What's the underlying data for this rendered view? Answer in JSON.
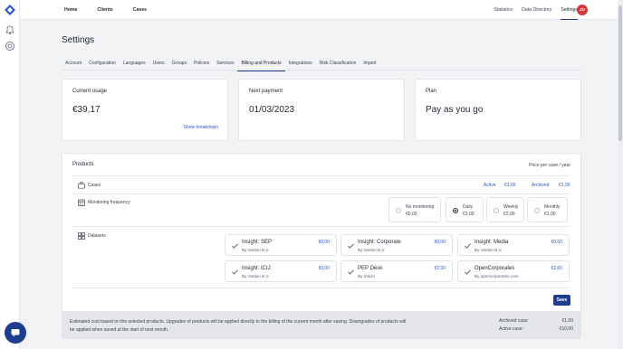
{
  "topnav": {
    "left": [
      "Home",
      "Clients",
      "Cases"
    ],
    "right": [
      "Statistics",
      "Data Directory",
      "Settings"
    ],
    "active": "Settings",
    "avatar_initials": "JD"
  },
  "page": {
    "title": "Settings"
  },
  "tabs": [
    "Account",
    "Configuration",
    "Languages",
    "Users",
    "Groups",
    "Policies",
    "Services",
    "Billing and Products",
    "Integrations",
    "Risk Classification",
    "Import"
  ],
  "active_tab": "Billing and Products",
  "summary": {
    "current_usage": {
      "label": "Current usage",
      "value": "€39,17",
      "link": "Show breakdown"
    },
    "next_payment": {
      "label": "Next payment",
      "value": "01/03/2023"
    },
    "plan": {
      "label": "Plan",
      "value": "Pay as you go"
    }
  },
  "products": {
    "title": "Products",
    "price_header": "Price per case / year",
    "cases": {
      "label": "Cases",
      "active_label": "Active",
      "active_price": "€3,00",
      "archived_label": "Archived",
      "archived_price": "€1,00"
    },
    "monitoring": {
      "label": "Monitoring frequency",
      "options": [
        {
          "name": "No monitoring",
          "price": "€0,00",
          "selected": false
        },
        {
          "name": "Daily",
          "price": "€3,00",
          "selected": true
        },
        {
          "name": "Weekly",
          "price": "€2,00",
          "selected": false
        },
        {
          "name": "Monthly",
          "price": "€1,00",
          "selected": false
        }
      ]
    },
    "datasets": {
      "label": "Datasets",
      "items": [
        {
          "name": "Insight: SEP",
          "by": "By Vartion B.V.",
          "price": "€0,00"
        },
        {
          "name": "Insight: Corporate",
          "by": "By Vartion B.V.",
          "price": "€0,00"
        },
        {
          "name": "Insight: Media",
          "by": "By Vartion B.V.",
          "price": "€0,00"
        },
        {
          "name": "Insight: ICIJ",
          "by": "By Vartion B.V.",
          "price": "€0,00"
        },
        {
          "name": "PEP Desk",
          "by": "By Info4c",
          "price": "€2,00"
        },
        {
          "name": "OpenCorporates",
          "by": "By opencorporates.com",
          "price": "€2,00"
        }
      ]
    },
    "save_label": "Save"
  },
  "footer": {
    "note": "Estimated cost based on the selected products. Upgrades of products will be applied directly to the billing of the current month after saving. Downgrades of products will be applied when saved at the start of next month.",
    "archived_label": "Archived case:",
    "archived_value": "€1,00",
    "active_label": "Active case:",
    "active_value": "€10,00"
  },
  "colors": {
    "accent": "#1d3d8f",
    "link": "#2a57c7",
    "avatar": "#d8353c"
  }
}
